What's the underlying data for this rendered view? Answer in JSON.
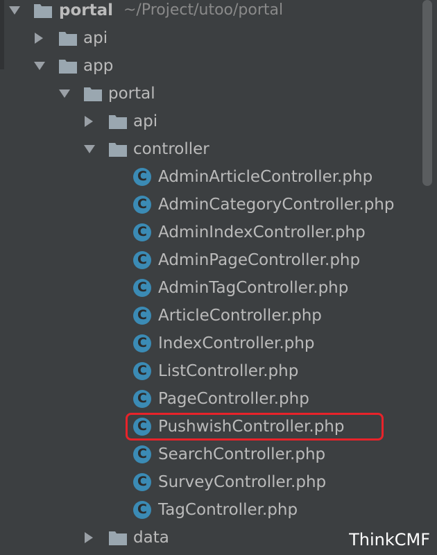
{
  "tree": {
    "root": {
      "label": "portal",
      "path": "~/Project/utoo/portal",
      "icon": "folder-icon",
      "expanded": true
    },
    "items": [
      {
        "label": "api",
        "expanded": false,
        "kind": "folder"
      },
      {
        "label": "app",
        "expanded": true,
        "kind": "folder"
      },
      {
        "label": "portal",
        "expanded": true,
        "kind": "folder"
      },
      {
        "label": "api",
        "expanded": false,
        "kind": "folder"
      },
      {
        "label": "controller",
        "expanded": true,
        "kind": "folder"
      },
      {
        "label": "AdminArticleController.php",
        "kind": "class"
      },
      {
        "label": "AdminCategoryController.php",
        "kind": "class"
      },
      {
        "label": "AdminIndexController.php",
        "kind": "class"
      },
      {
        "label": "AdminPageController.php",
        "kind": "class"
      },
      {
        "label": "AdminTagController.php",
        "kind": "class"
      },
      {
        "label": "ArticleController.php",
        "kind": "class"
      },
      {
        "label": "IndexController.php",
        "kind": "class"
      },
      {
        "label": "ListController.php",
        "kind": "class"
      },
      {
        "label": "PageController.php",
        "kind": "class"
      },
      {
        "label": "PushwishController.php",
        "kind": "class",
        "highlighted": true
      },
      {
        "label": "SearchController.php",
        "kind": "class"
      },
      {
        "label": "SurveyController.php",
        "kind": "class"
      },
      {
        "label": "TagController.php",
        "kind": "class"
      },
      {
        "label": "data",
        "expanded": false,
        "kind": "folder"
      }
    ],
    "class_icon_letter": "C"
  },
  "watermark": "ThinkCMF",
  "colors": {
    "background": "#3c3f41",
    "text": "#bbbbbb",
    "folder": "#9aa7b0",
    "class_icon": "#3b8bb5",
    "highlight": "#e8232a"
  }
}
